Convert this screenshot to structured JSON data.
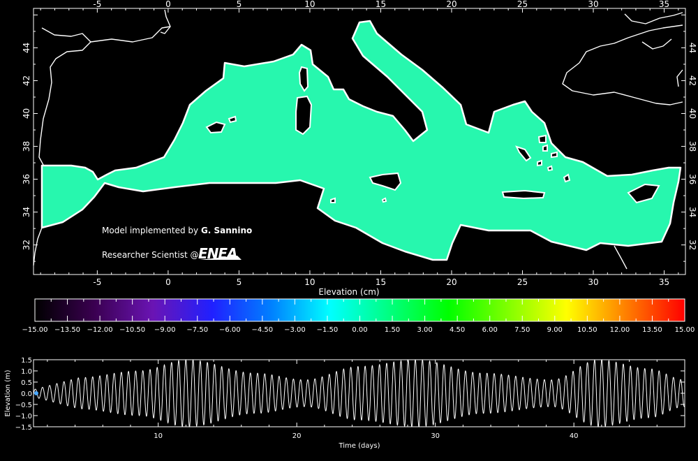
{
  "map": {
    "lon_ticks": [
      "-5",
      "0",
      "5",
      "10",
      "15",
      "20",
      "25",
      "30",
      "35"
    ],
    "lat_ticks": [
      "32",
      "34",
      "36",
      "38",
      "40",
      "42",
      "44"
    ],
    "lon_range": [
      -9.5,
      36.5
    ],
    "lat_range": [
      30.2,
      46.4
    ],
    "credit_line1_prefix": "Model implemented by ",
    "credit_line1_name": "G. Sannino",
    "credit_line2_prefix": "Researcher Scientist @",
    "logo_text": "ENEA",
    "sea_color": "#27f7ae",
    "land_color": "#000000",
    "coast_color": "#ffffff"
  },
  "colorbar": {
    "title": "Elevation (cm)",
    "tick_labels": [
      "-15.00",
      "-13.50",
      "-12.00",
      "-10.50",
      "-9.00",
      "-7.50",
      "-6.00",
      "-4.50",
      "-3.00",
      "-1.50",
      "0.00",
      "1.50",
      "3.00",
      "4.50",
      "6.00",
      "7.50",
      "9.00",
      "10.50",
      "12.00",
      "13.50",
      "15.00"
    ],
    "range": [
      -15,
      15
    ],
    "colors": [
      "#000000",
      "#3a0050",
      "#6a14b4",
      "#2020ff",
      "#0080ff",
      "#00ffff",
      "#00ff80",
      "#00ff00",
      "#80ff00",
      "#ffff00",
      "#ff8000",
      "#ff0000"
    ]
  },
  "chart_data": {
    "type": "line",
    "xlabel": "Time (days)",
    "ylabel": "Elevation (m)",
    "xlim": [
      1,
      48
    ],
    "ylim": [
      -1.5,
      1.5
    ],
    "x_ticks": [
      "10",
      "20",
      "30",
      "40"
    ],
    "y_ticks": [
      "1.5",
      "1.0",
      "0.5",
      "0.0",
      "-0.5",
      "-1.0",
      "-1.5"
    ],
    "series": [
      {
        "model": "semi-diurnal tide with spring-neap modulation",
        "period_days": 0.5175,
        "envelope_days": [
          4.3,
          8.6,
          12.1,
          17.0,
          20.6,
          24.5,
          28.6,
          33.5,
          38.4,
          41.8,
          45.4,
          48.0
        ],
        "envelope_amplitude_m": [
          0.7,
          1.0,
          1.5,
          0.9,
          0.6,
          1.2,
          1.5,
          0.9,
          0.6,
          1.5,
          1.1,
          0.6
        ]
      }
    ],
    "current_time_marker": {
      "x": 1.2,
      "y": 0.0,
      "color": "#4aa8ff"
    }
  }
}
